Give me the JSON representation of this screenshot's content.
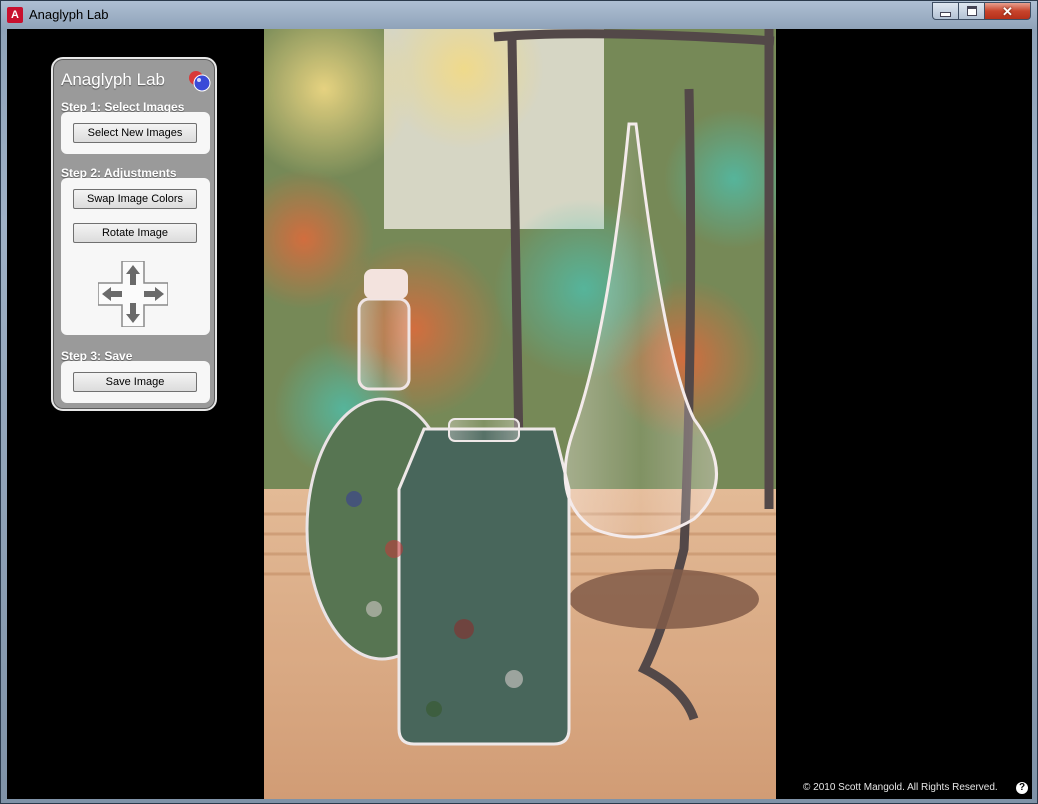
{
  "window": {
    "title": "Anaglyph Lab",
    "app_icon": "adobe-air-icon",
    "controls": {
      "minimize": "minimize-icon",
      "maximize": "maximize-icon",
      "close_glyph": "✕"
    }
  },
  "panel": {
    "title": "Anaglyph Lab",
    "logo": "anaglyph-spheres-icon",
    "step1": {
      "label": "Step 1: Select Images",
      "button": "Select New Images"
    },
    "step2": {
      "label": "Step 2: Adjustments",
      "swap_button": "Swap Image Colors",
      "rotate_button": "Rotate Image",
      "nudge_pad": [
        "arrow-up-icon",
        "arrow-down-icon",
        "arrow-left-icon",
        "arrow-right-icon"
      ]
    },
    "step3": {
      "label": "Step 3: Save",
      "button": "Save Image"
    }
  },
  "footer": {
    "copyright": "© 2010 Scott Mangold. All Rights Reserved.",
    "help_glyph": "?"
  },
  "colors": {
    "client_bg": "#000000",
    "panel_bg": "#9a9a9a",
    "panel_box": "#f7f7f7",
    "close_red": "#c8442c"
  }
}
